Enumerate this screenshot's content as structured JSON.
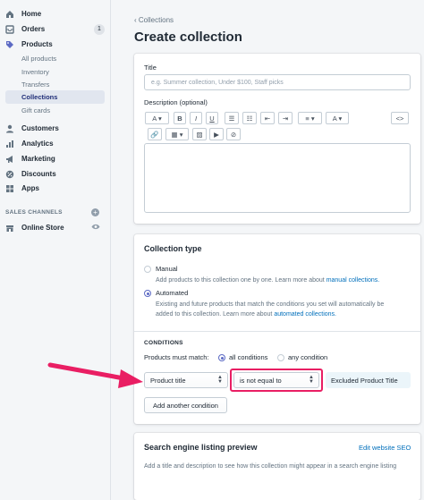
{
  "sidebar": {
    "items": [
      {
        "label": "Home",
        "icon": "home-icon"
      },
      {
        "label": "Orders",
        "icon": "orders-icon",
        "badge": "1"
      },
      {
        "label": "Products",
        "icon": "tag-icon"
      }
    ],
    "product_sub": [
      {
        "label": "All products"
      },
      {
        "label": "Inventory"
      },
      {
        "label": "Transfers"
      },
      {
        "label": "Collections"
      },
      {
        "label": "Gift cards"
      }
    ],
    "items2": [
      {
        "label": "Customers",
        "icon": "person-icon"
      },
      {
        "label": "Analytics",
        "icon": "bar-chart-icon"
      },
      {
        "label": "Marketing",
        "icon": "megaphone-icon"
      },
      {
        "label": "Discounts",
        "icon": "discount-icon"
      },
      {
        "label": "Apps",
        "icon": "apps-icon"
      }
    ],
    "channels_label": "SALES CHANNELS",
    "online_store": "Online Store"
  },
  "header": {
    "breadcrumb": "Collections",
    "title": "Create collection"
  },
  "details": {
    "title_label": "Title",
    "title_placeholder": "e.g. Summer collection, Under $100, Staff picks",
    "description_label": "Description (optional)"
  },
  "collection_type": {
    "heading": "Collection type",
    "manual_label": "Manual",
    "manual_help": "Add products to this collection one by one. Learn more about",
    "manual_link": "manual collections.",
    "automated_label": "Automated",
    "automated_help_1": "Existing and future products that match the conditions you set will automatically be",
    "automated_help_2": "added to this collection. Learn more about",
    "automated_link": "automated collections.",
    "selected": "automated"
  },
  "conditions": {
    "heading": "CONDITIONS",
    "match_label": "Products must match:",
    "all_label": "all conditions",
    "any_label": "any condition",
    "field_value": "Product title",
    "operator_value": "is not equal to",
    "value": "Excluded Product Title",
    "add_button": "Add another condition"
  },
  "seo": {
    "heading": "Search engine listing preview",
    "edit_link": "Edit website SEO",
    "help": "Add a title and description to see how this collection might appear in a search engine listing"
  },
  "colors": {
    "accent": "#5c6ac4",
    "link": "#006fbb",
    "highlight": "#e91e63"
  }
}
